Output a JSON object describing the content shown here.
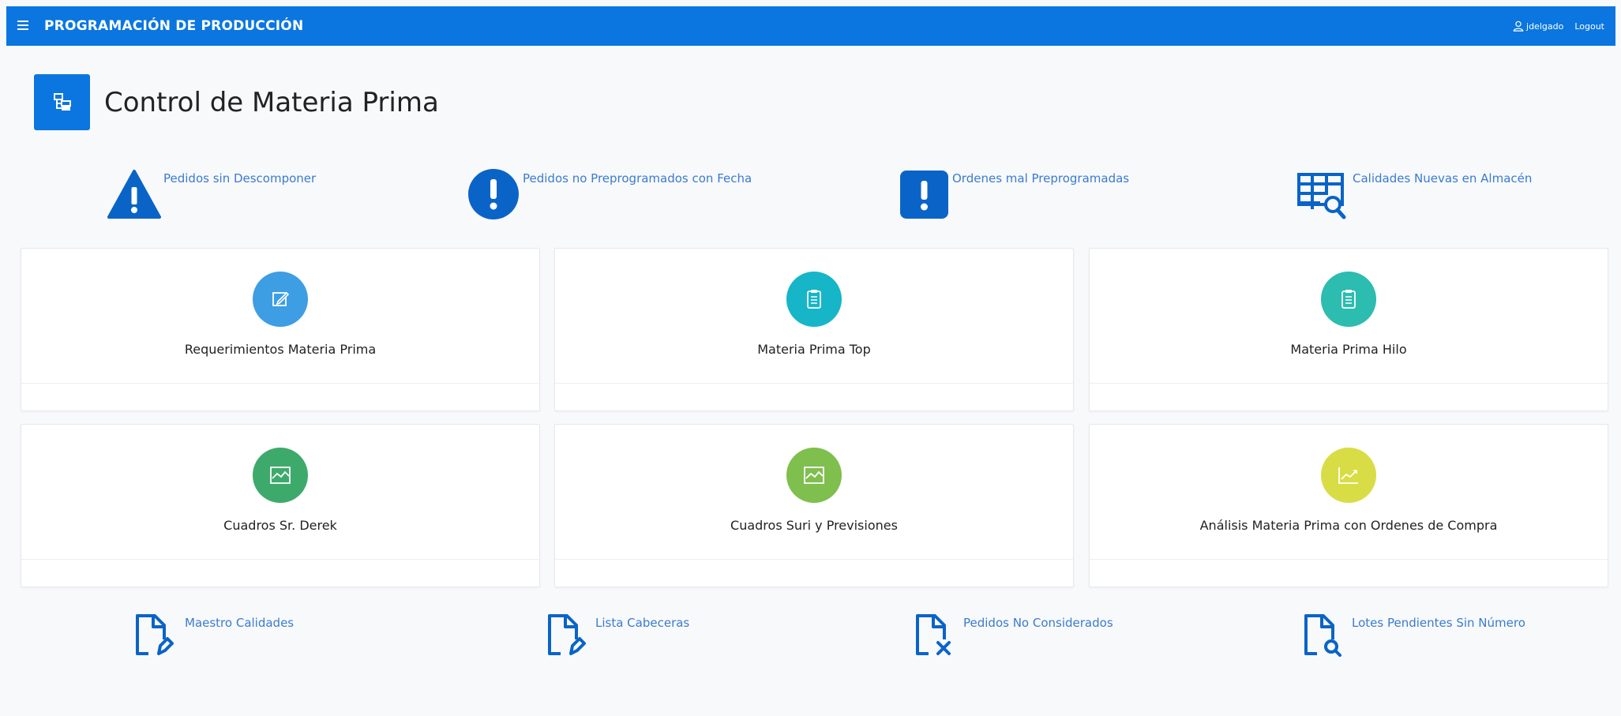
{
  "header": {
    "app_title": "PROGRAMACIÓN DE PRODUCCIÓN",
    "username": "jdelgado",
    "logout_label": "Logout",
    "color": "#0b76df"
  },
  "page": {
    "title": "Control de Materia Prima",
    "icon": "sitemap-icon"
  },
  "top_links": [
    {
      "label": "Pedidos sin Descomponer",
      "icon": "warning-triangle-icon"
    },
    {
      "label": "Pedidos no Preprogramados con Fecha",
      "icon": "exclamation-circle-icon"
    },
    {
      "label": "Ordenes mal Preprogramadas",
      "icon": "exclamation-square-icon"
    },
    {
      "label": "Calidades Nuevas en Almacén",
      "icon": "table-search-icon"
    }
  ],
  "cards": [
    {
      "label": "Requerimientos Materia Prima",
      "icon": "edit-icon",
      "color": "#3e9ee3"
    },
    {
      "label": "Materia Prima Top",
      "icon": "clipboard-icon",
      "color": "#17b5c8"
    },
    {
      "label": "Materia Prima Hilo",
      "icon": "clipboard-icon",
      "color": "#2cbcb0"
    },
    {
      "label": "Cuadros Sr. Derek",
      "icon": "area-chart-icon",
      "color": "#3daa6c"
    },
    {
      "label": "Cuadros Suri y Previsiones",
      "icon": "area-chart-icon",
      "color": "#7fbf4d"
    },
    {
      "label": "Análisis Materia Prima con Ordenes de Compra",
      "icon": "line-chart-icon",
      "color": "#d9dd45"
    }
  ],
  "bottom_links": [
    {
      "label": "Maestro Calidades",
      "icon": "file-edit-icon"
    },
    {
      "label": "Lista Cabeceras",
      "icon": "file-edit-icon"
    },
    {
      "label": "Pedidos No Considerados",
      "icon": "file-x-icon"
    },
    {
      "label": "Lotes Pendientes Sin Número",
      "icon": "file-search-icon"
    }
  ]
}
